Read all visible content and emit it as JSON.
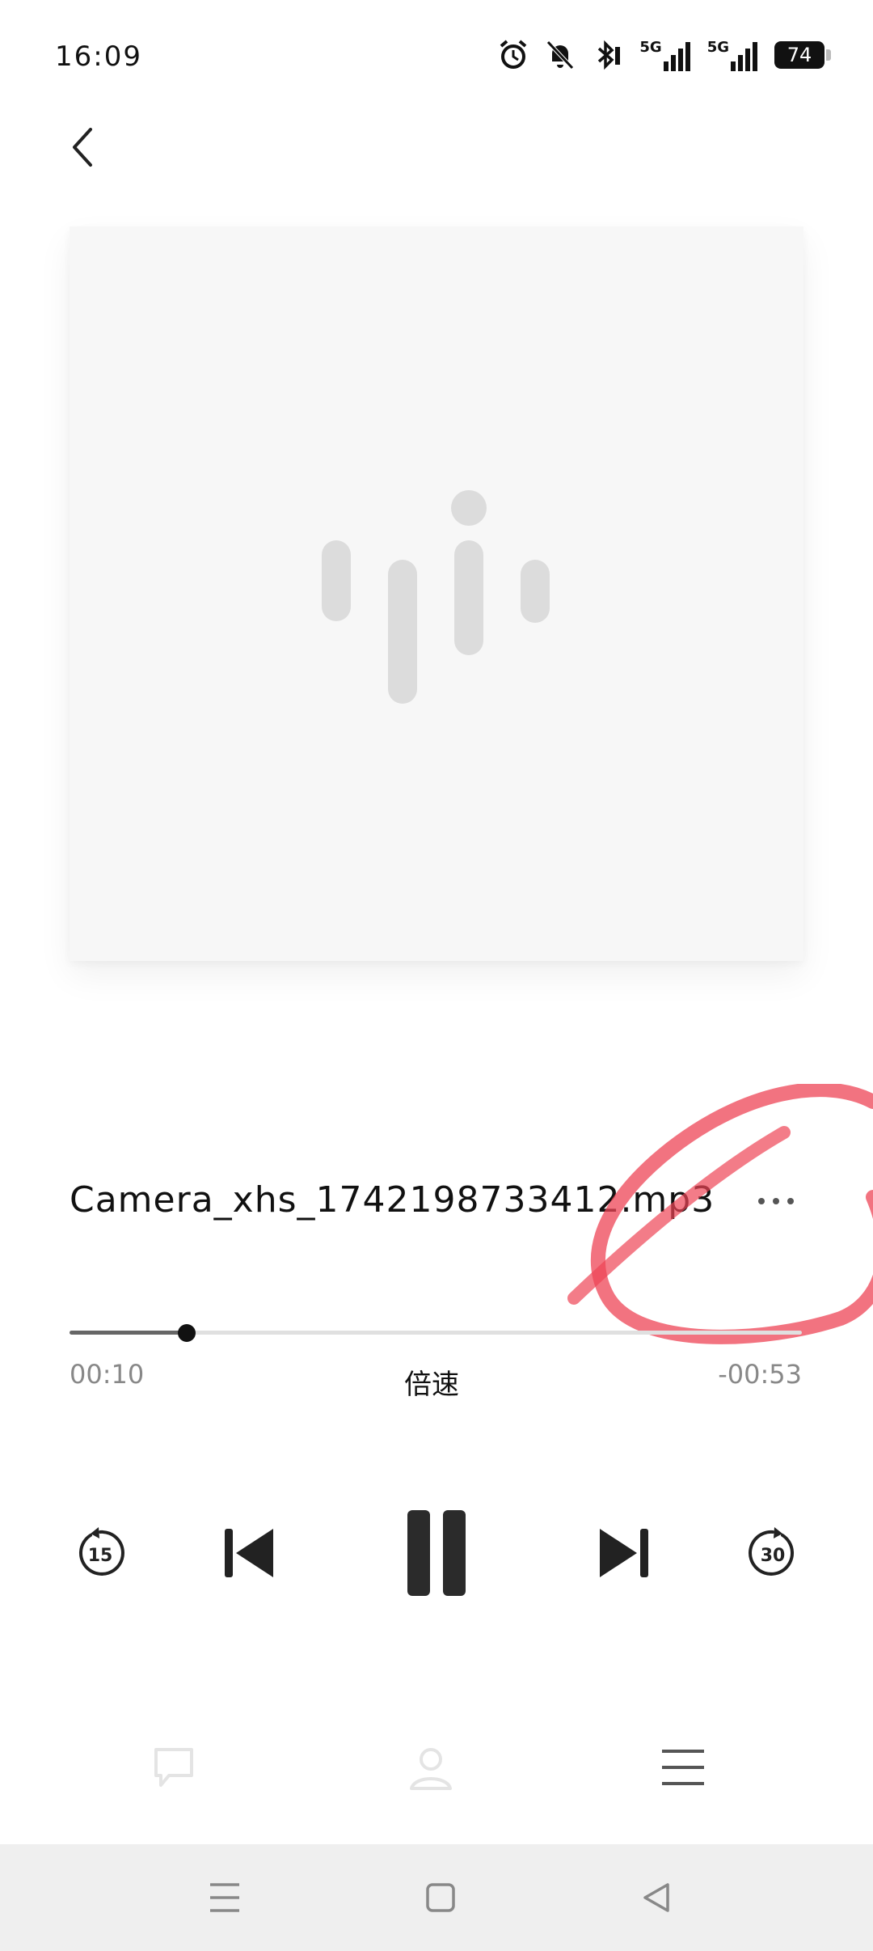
{
  "status_bar": {
    "time": "16:09",
    "battery": "74",
    "network_1": "5G",
    "network_2": "5G",
    "icons": [
      "alarm-icon",
      "mute-bell-icon",
      "bluetooth-icon",
      "signal-icon",
      "signal-icon",
      "battery-icon"
    ]
  },
  "player": {
    "title": "Camera_xhs_1742198733412.mp3",
    "elapsed": "00:10",
    "remaining": "-00:53",
    "speed_label": "倍速",
    "progress_fraction": 0.16,
    "rewind_seconds": "15",
    "forward_seconds": "30"
  },
  "colors": {
    "annotation": "#ee4455",
    "artwork_bg": "#f7f7f7",
    "control": "#2b2b2b"
  }
}
